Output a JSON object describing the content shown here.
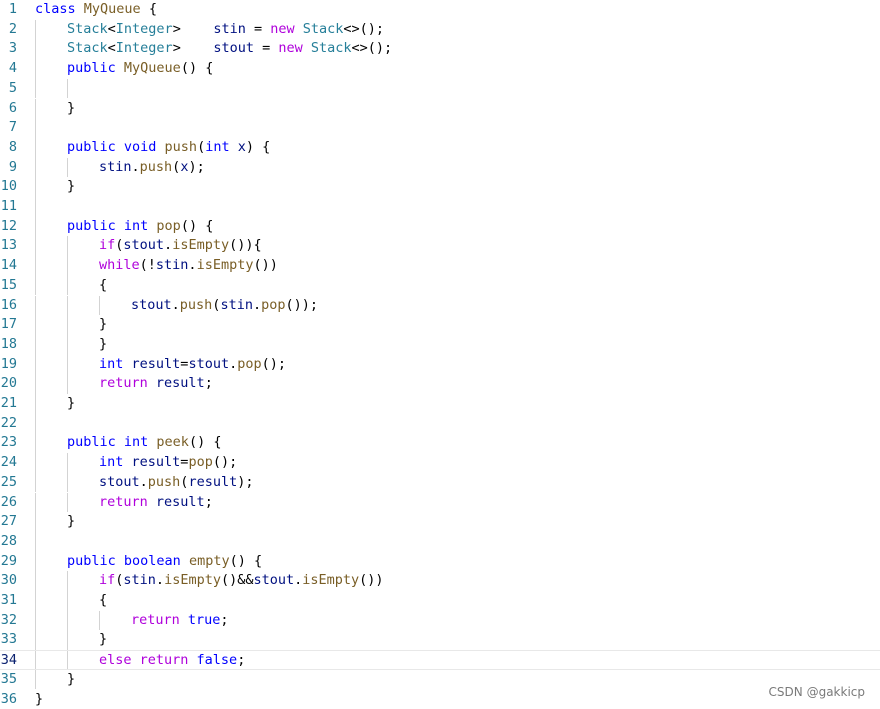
{
  "editor": {
    "current_line": 34,
    "colors": {
      "keyword": "#0000ff",
      "control": "#af00db",
      "type": "#267f99",
      "function": "#795e26",
      "variable": "#001080",
      "line_number": "#237893",
      "indent_guide": "#d3d3d3"
    },
    "lines": [
      {
        "n": "1",
        "indent": 0,
        "tokens": [
          [
            "class ",
            "kw"
          ],
          [
            "MyQueue",
            "fn"
          ],
          [
            " {",
            ""
          ]
        ]
      },
      {
        "n": "2",
        "indent": 1,
        "tokens": [
          [
            "Stack",
            "type"
          ],
          [
            "<",
            ""
          ],
          [
            "Integer",
            "type"
          ],
          [
            ">    ",
            ""
          ],
          [
            "stin",
            "var"
          ],
          [
            " = ",
            ""
          ],
          [
            "new ",
            "ctl"
          ],
          [
            "Stack",
            "type"
          ],
          [
            "<>();",
            ""
          ]
        ]
      },
      {
        "n": "3",
        "indent": 1,
        "tokens": [
          [
            "Stack",
            "type"
          ],
          [
            "<",
            ""
          ],
          [
            "Integer",
            "type"
          ],
          [
            ">    ",
            ""
          ],
          [
            "stout",
            "var"
          ],
          [
            " = ",
            ""
          ],
          [
            "new ",
            "ctl"
          ],
          [
            "Stack",
            "type"
          ],
          [
            "<>();",
            ""
          ]
        ]
      },
      {
        "n": "4",
        "indent": 1,
        "tokens": [
          [
            "public ",
            "kw"
          ],
          [
            "MyQueue",
            "fn"
          ],
          [
            "() {",
            ""
          ]
        ]
      },
      {
        "n": "5",
        "indent": 2,
        "tokens": []
      },
      {
        "n": "6",
        "indent": 1,
        "tokens": [
          [
            "}",
            ""
          ]
        ]
      },
      {
        "n": "7",
        "indent": 1,
        "tokens": []
      },
      {
        "n": "8",
        "indent": 1,
        "tokens": [
          [
            "public ",
            "kw"
          ],
          [
            "void ",
            "kw"
          ],
          [
            "push",
            "fn"
          ],
          [
            "(",
            ""
          ],
          [
            "int ",
            "kw"
          ],
          [
            "x",
            "var"
          ],
          [
            ") {",
            ""
          ]
        ]
      },
      {
        "n": "9",
        "indent": 2,
        "tokens": [
          [
            "stin",
            "var"
          ],
          [
            ".",
            ""
          ],
          [
            "push",
            "fn"
          ],
          [
            "(",
            ""
          ],
          [
            "x",
            "var"
          ],
          [
            ");",
            ""
          ]
        ]
      },
      {
        "n": "10",
        "indent": 1,
        "tokens": [
          [
            "}",
            ""
          ]
        ]
      },
      {
        "n": "11",
        "indent": 1,
        "tokens": []
      },
      {
        "n": "12",
        "indent": 1,
        "tokens": [
          [
            "public ",
            "kw"
          ],
          [
            "int ",
            "kw"
          ],
          [
            "pop",
            "fn"
          ],
          [
            "() {",
            ""
          ]
        ]
      },
      {
        "n": "13",
        "indent": 2,
        "tokens": [
          [
            "if",
            "ctl"
          ],
          [
            "(",
            ""
          ],
          [
            "stout",
            "var"
          ],
          [
            ".",
            ""
          ],
          [
            "isEmpty",
            "fn"
          ],
          [
            "()){",
            ""
          ]
        ]
      },
      {
        "n": "14",
        "indent": 2,
        "tokens": [
          [
            "while",
            "ctl"
          ],
          [
            "(!",
            ""
          ],
          [
            "stin",
            "var"
          ],
          [
            ".",
            ""
          ],
          [
            "isEmpty",
            "fn"
          ],
          [
            "())",
            ""
          ]
        ]
      },
      {
        "n": "15",
        "indent": 2,
        "tokens": [
          [
            "{",
            ""
          ]
        ]
      },
      {
        "n": "16",
        "indent": 3,
        "tokens": [
          [
            "stout",
            "var"
          ],
          [
            ".",
            ""
          ],
          [
            "push",
            "fn"
          ],
          [
            "(",
            ""
          ],
          [
            "stin",
            "var"
          ],
          [
            ".",
            ""
          ],
          [
            "pop",
            "fn"
          ],
          [
            "());",
            ""
          ]
        ]
      },
      {
        "n": "17",
        "indent": 2,
        "tokens": [
          [
            "}",
            ""
          ]
        ]
      },
      {
        "n": "18",
        "indent": 2,
        "tokens": [
          [
            "}",
            ""
          ]
        ]
      },
      {
        "n": "19",
        "indent": 2,
        "tokens": [
          [
            "int ",
            "kw"
          ],
          [
            "result",
            "var"
          ],
          [
            "=",
            ""
          ],
          [
            "stout",
            "var"
          ],
          [
            ".",
            ""
          ],
          [
            "pop",
            "fn"
          ],
          [
            "();",
            ""
          ]
        ]
      },
      {
        "n": "20",
        "indent": 2,
        "tokens": [
          [
            "return ",
            "ctl"
          ],
          [
            "result",
            "var"
          ],
          [
            ";",
            ""
          ]
        ]
      },
      {
        "n": "21",
        "indent": 1,
        "tokens": [
          [
            "}",
            ""
          ]
        ]
      },
      {
        "n": "22",
        "indent": 1,
        "tokens": []
      },
      {
        "n": "23",
        "indent": 1,
        "tokens": [
          [
            "public ",
            "kw"
          ],
          [
            "int ",
            "kw"
          ],
          [
            "peek",
            "fn"
          ],
          [
            "() {",
            ""
          ]
        ]
      },
      {
        "n": "24",
        "indent": 2,
        "tokens": [
          [
            "int ",
            "kw"
          ],
          [
            "result",
            "var"
          ],
          [
            "=",
            ""
          ],
          [
            "pop",
            "fn"
          ],
          [
            "();",
            ""
          ]
        ]
      },
      {
        "n": "25",
        "indent": 2,
        "tokens": [
          [
            "stout",
            "var"
          ],
          [
            ".",
            ""
          ],
          [
            "push",
            "fn"
          ],
          [
            "(",
            ""
          ],
          [
            "result",
            "var"
          ],
          [
            ");",
            ""
          ]
        ]
      },
      {
        "n": "26",
        "indent": 2,
        "tokens": [
          [
            "return ",
            "ctl"
          ],
          [
            "result",
            "var"
          ],
          [
            ";",
            ""
          ]
        ]
      },
      {
        "n": "27",
        "indent": 1,
        "tokens": [
          [
            "}",
            ""
          ]
        ]
      },
      {
        "n": "28",
        "indent": 1,
        "tokens": []
      },
      {
        "n": "29",
        "indent": 1,
        "tokens": [
          [
            "public ",
            "kw"
          ],
          [
            "boolean ",
            "kw"
          ],
          [
            "empty",
            "fn"
          ],
          [
            "() {",
            ""
          ]
        ]
      },
      {
        "n": "30",
        "indent": 2,
        "tokens": [
          [
            "if",
            "ctl"
          ],
          [
            "(",
            ""
          ],
          [
            "stin",
            "var"
          ],
          [
            ".",
            ""
          ],
          [
            "isEmpty",
            "fn"
          ],
          [
            "()&&",
            ""
          ],
          [
            "stout",
            "var"
          ],
          [
            ".",
            ""
          ],
          [
            "isEmpty",
            "fn"
          ],
          [
            "())",
            ""
          ]
        ]
      },
      {
        "n": "31",
        "indent": 2,
        "tokens": [
          [
            "{",
            ""
          ]
        ]
      },
      {
        "n": "32",
        "indent": 3,
        "tokens": [
          [
            "return ",
            "ctl"
          ],
          [
            "true",
            "kw"
          ],
          [
            ";",
            ""
          ]
        ]
      },
      {
        "n": "33",
        "indent": 2,
        "tokens": [
          [
            "}",
            ""
          ]
        ]
      },
      {
        "n": "34",
        "indent": 2,
        "tokens": [
          [
            "else ",
            "ctl"
          ],
          [
            "return ",
            "ctl"
          ],
          [
            "false",
            "kw"
          ],
          [
            ";",
            ""
          ]
        ]
      },
      {
        "n": "35",
        "indent": 1,
        "tokens": [
          [
            "}",
            ""
          ]
        ]
      },
      {
        "n": "36",
        "indent": 0,
        "tokens": [
          [
            "}",
            ""
          ]
        ]
      }
    ]
  },
  "watermark": "CSDN @gakkicp"
}
